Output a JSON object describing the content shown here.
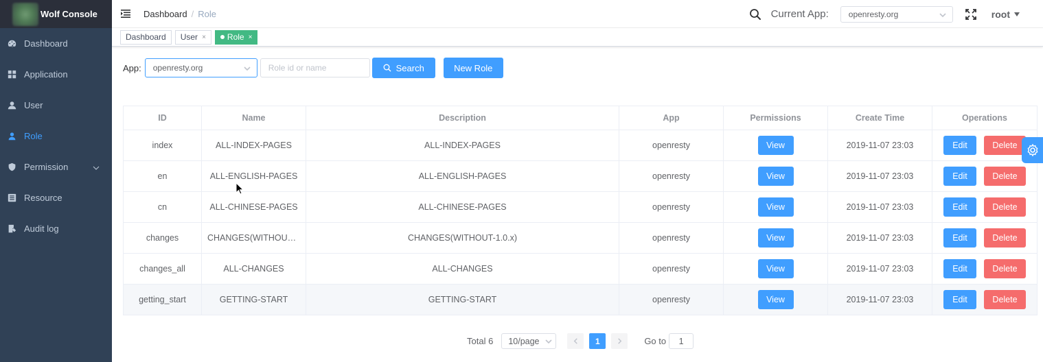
{
  "app_title": "Wolf Console",
  "sidebar": {
    "items": [
      {
        "label": "Dashboard",
        "icon": "dashboard-icon"
      },
      {
        "label": "Application",
        "icon": "grid-icon"
      },
      {
        "label": "User",
        "icon": "user-icon"
      },
      {
        "label": "Role",
        "icon": "role-icon",
        "active": true
      },
      {
        "label": "Permission",
        "icon": "lock-icon",
        "has_submenu": true
      },
      {
        "label": "Resource",
        "icon": "list-icon"
      },
      {
        "label": "Audit log",
        "icon": "audit-icon"
      }
    ]
  },
  "navbar": {
    "breadcrumb": [
      "Dashboard",
      "Role"
    ],
    "current_app_label": "Current App:",
    "current_app_value": "openresty.org",
    "user": "root"
  },
  "tags": [
    {
      "label": "Dashboard",
      "closable": false
    },
    {
      "label": "User",
      "closable": true
    },
    {
      "label": "Role",
      "closable": true,
      "active": true
    }
  ],
  "filter": {
    "app_label": "App:",
    "app_value": "openresty.org",
    "search_placeholder": "Role id or name",
    "search_button": "Search",
    "new_button": "New Role"
  },
  "table": {
    "columns": [
      "ID",
      "Name",
      "Description",
      "App",
      "Permissions",
      "Create Time",
      "Operations"
    ],
    "rows": [
      {
        "id": "index",
        "name": "ALL-INDEX-PAGES",
        "description": "ALL-INDEX-PAGES",
        "app": "openresty",
        "create_time": "2019-11-07 23:03"
      },
      {
        "id": "en",
        "name": "ALL-ENGLISH-PAGES",
        "description": "ALL-ENGLISH-PAGES",
        "app": "openresty",
        "create_time": "2019-11-07 23:03"
      },
      {
        "id": "cn",
        "name": "ALL-CHINESE-PAGES",
        "description": "ALL-CHINESE-PAGES",
        "app": "openresty",
        "create_time": "2019-11-07 23:03"
      },
      {
        "id": "changes",
        "name": "CHANGES(WITHOUT-…",
        "description": "CHANGES(WITHOUT-1.0.x)",
        "app": "openresty",
        "create_time": "2019-11-07 23:03"
      },
      {
        "id": "changes_all",
        "name": "ALL-CHANGES",
        "description": "ALL-CHANGES",
        "app": "openresty",
        "create_time": "2019-11-07 23:03"
      },
      {
        "id": "getting_start",
        "name": "GETTING-START",
        "description": "GETTING-START",
        "app": "openresty",
        "create_time": "2019-11-07 23:03"
      }
    ],
    "view_label": "View",
    "edit_label": "Edit",
    "delete_label": "Delete"
  },
  "pagination": {
    "total_text": "Total 6",
    "page_size": "10/page",
    "current_page": "1",
    "goto_label": "Go to",
    "goto_value": "1"
  },
  "colors": {
    "sidebar_bg": "#304156",
    "primary": "#409eff",
    "danger": "#f56c6c",
    "tag_active": "#42b983"
  }
}
